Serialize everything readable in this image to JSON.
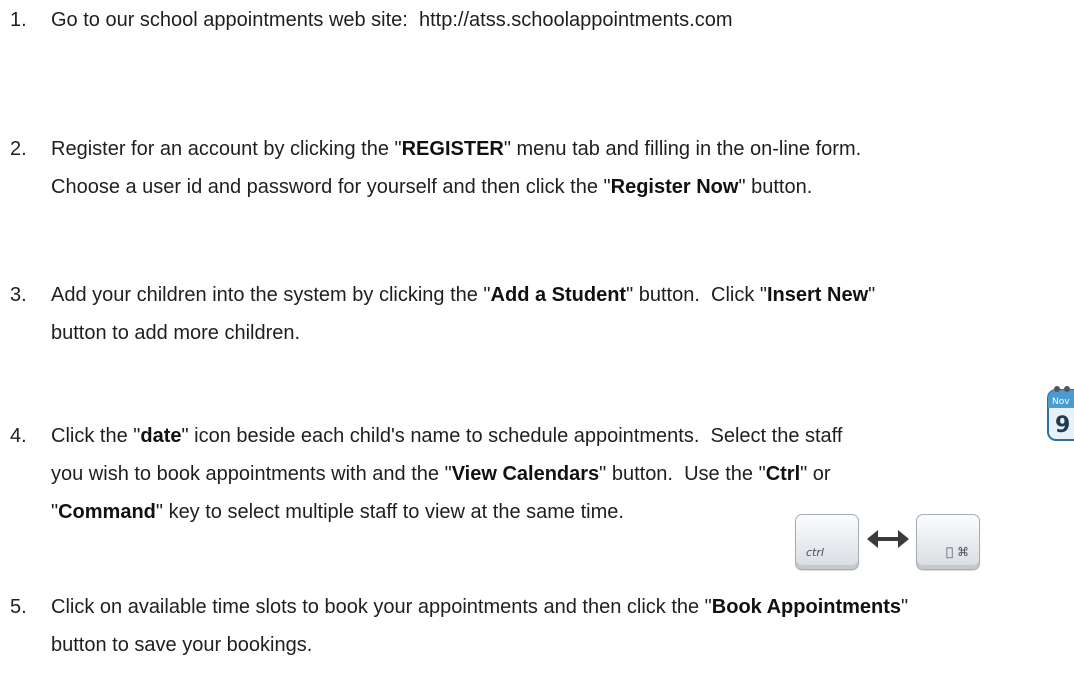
{
  "steps": [
    {
      "number": "1.",
      "lines": [
        [
          {
            "t": "Go to our school appointments web site:  http://atss.schoolappointments.com",
            "b": false
          }
        ]
      ]
    },
    {
      "number": "2.",
      "lines": [
        [
          {
            "t": "Register for an account by clicking the \"",
            "b": false
          },
          {
            "t": "REGISTER",
            "b": true
          },
          {
            "t": "\" menu tab and filling in the on-line form.",
            "b": false
          }
        ],
        [
          {
            "t": "Choose a user id and password for yourself and then click the \"",
            "b": false
          },
          {
            "t": "Register Now",
            "b": true
          },
          {
            "t": "\" button.",
            "b": false
          }
        ]
      ]
    },
    {
      "number": "3.",
      "lines": [
        [
          {
            "t": "Add your children into the system by clicking the \"",
            "b": false
          },
          {
            "t": "Add a Student",
            "b": true
          },
          {
            "t": "\" button.  Click \"",
            "b": false
          },
          {
            "t": "Insert New",
            "b": true
          },
          {
            "t": "\"",
            "b": false
          }
        ],
        [
          {
            "t": "button to add more children.",
            "b": false
          }
        ]
      ]
    },
    {
      "number": "4.",
      "lines": [
        [
          {
            "t": "Click the \"",
            "b": false
          },
          {
            "t": "date",
            "b": true
          },
          {
            "t": "\" icon beside each child's name to schedule appointments.  Select the staff",
            "b": false
          }
        ],
        [
          {
            "t": "you wish to book appointments with and the \"",
            "b": false
          },
          {
            "t": "View Calendars",
            "b": true
          },
          {
            "t": "\" button.  Use the \"",
            "b": false
          },
          {
            "t": "Ctrl",
            "b": true
          },
          {
            "t": "\" or",
            "b": false
          }
        ],
        [
          {
            "t": "\"",
            "b": false
          },
          {
            "t": "Command",
            "b": true
          },
          {
            "t": "\" key to select multiple staff to view at the same time.",
            "b": false
          }
        ]
      ]
    },
    {
      "number": "5.",
      "lines": [
        [
          {
            "t": "Click on available time slots to book your appointments and then click the \"",
            "b": false
          },
          {
            "t": "Book Appointments",
            "b": true
          },
          {
            "t": "\"",
            "b": false
          }
        ],
        [
          {
            "t": "button to save your bookings.",
            "b": false
          }
        ]
      ]
    }
  ],
  "calendar_icon": {
    "name": "calendar-date-icon",
    "month": "Nov",
    "day": "9",
    "color": "#3d8fc4"
  },
  "keys": {
    "ctrl_label": "ctrl",
    "command_label": " ⌘",
    "arrow_icon": "double-arrow-icon"
  }
}
